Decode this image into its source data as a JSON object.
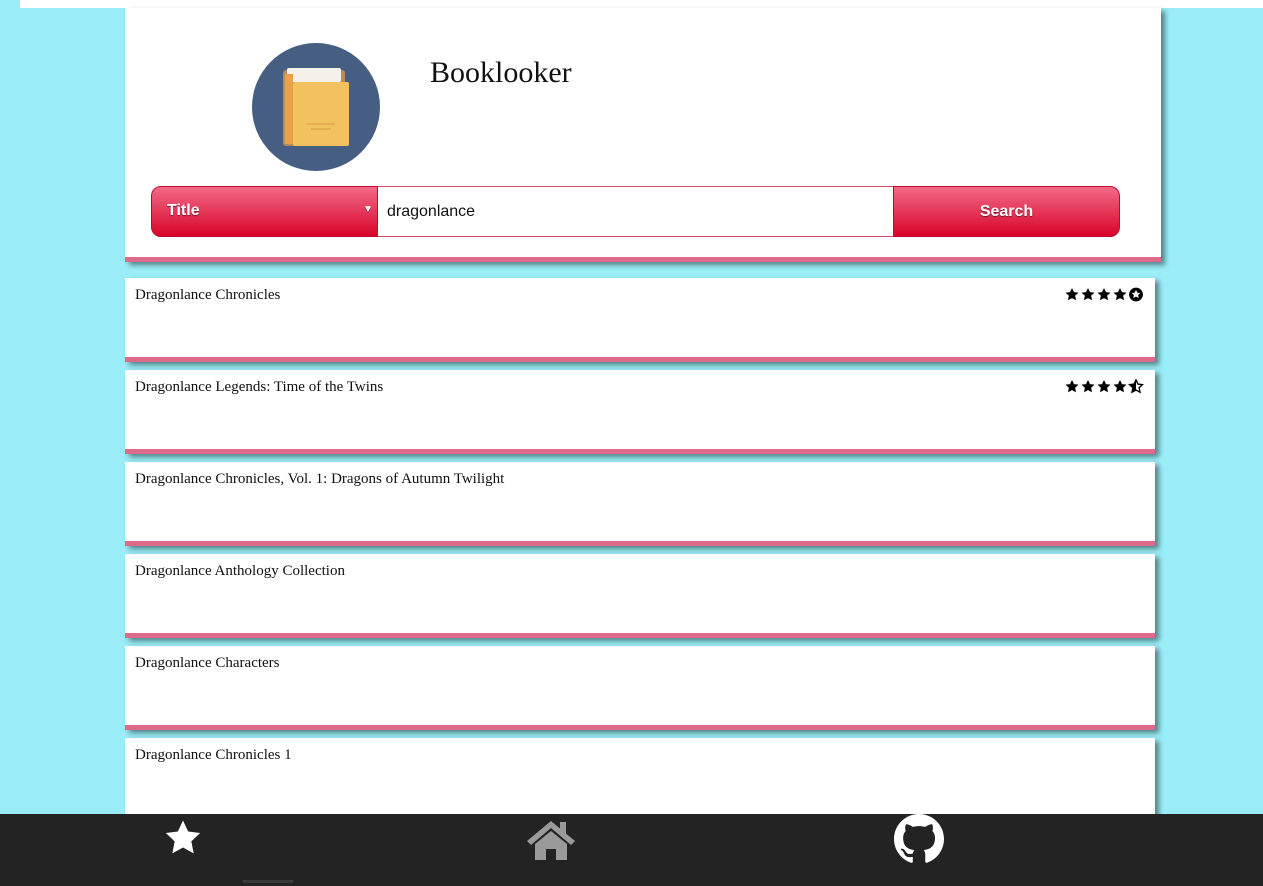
{
  "app": {
    "title": "Booklooker"
  },
  "search": {
    "field_selected": "Title",
    "query": "dragonlance",
    "button_label": "Search"
  },
  "results": [
    {
      "title": "Dragonlance Chronicles",
      "rating_stars": [
        "full",
        "full",
        "full",
        "full",
        "empty"
      ]
    },
    {
      "title": "Dragonlance Legends: Time of the Twins",
      "rating_stars": [
        "full",
        "full",
        "full",
        "full",
        "half"
      ]
    },
    {
      "title": "Dragonlance Chronicles, Vol. 1: Dragons of Autumn Twilight",
      "rating_stars": []
    },
    {
      "title": "Dragonlance Anthology Collection",
      "rating_stars": []
    },
    {
      "title": "Dragonlance Characters",
      "rating_stars": []
    },
    {
      "title": "Dragonlance Chronicles 1",
      "rating_stars": []
    }
  ],
  "nav": {
    "items": [
      {
        "icon": "star-icon",
        "color": "#ffffff"
      },
      {
        "icon": "home-icon",
        "color": "#9a9a9a"
      },
      {
        "icon": "github-icon",
        "color": "#ffffff"
      }
    ]
  },
  "colors": {
    "background": "#9aedf7",
    "accent": "#de6a8a",
    "button_gradient_top": "#f36a88",
    "button_gradient_bottom": "#d7042a",
    "logo_circle": "#455e82",
    "nav_bar": "#232323"
  }
}
